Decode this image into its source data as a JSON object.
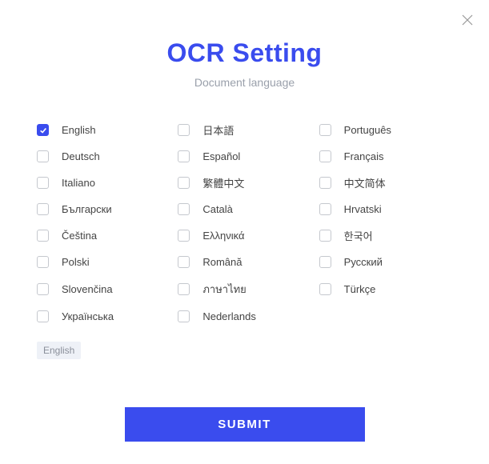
{
  "title": "OCR Setting",
  "subtitle": "Document language",
  "columns": [
    [
      {
        "label": "English",
        "checked": true
      },
      {
        "label": "Deutsch",
        "checked": false
      },
      {
        "label": "Italiano",
        "checked": false
      },
      {
        "label": "Български",
        "checked": false
      },
      {
        "label": "Čeština",
        "checked": false
      },
      {
        "label": "Polski",
        "checked": false
      },
      {
        "label": "Slovenčina",
        "checked": false
      },
      {
        "label": "Українська",
        "checked": false
      }
    ],
    [
      {
        "label": "日本語",
        "checked": false
      },
      {
        "label": "Español",
        "checked": false
      },
      {
        "label": "繁體中文",
        "checked": false
      },
      {
        "label": "Català",
        "checked": false
      },
      {
        "label": "Ελληνικά",
        "checked": false
      },
      {
        "label": "Română",
        "checked": false
      },
      {
        "label": "ภาษาไทย",
        "checked": false
      },
      {
        "label": "Nederlands",
        "checked": false
      }
    ],
    [
      {
        "label": "Português",
        "checked": false
      },
      {
        "label": "Français",
        "checked": false
      },
      {
        "label": "中文简体",
        "checked": false
      },
      {
        "label": "Hrvatski",
        "checked": false
      },
      {
        "label": "한국어",
        "checked": false
      },
      {
        "label": "Русский",
        "checked": false
      },
      {
        "label": "Türkçe",
        "checked": false
      }
    ]
  ],
  "selected_tag": "English",
  "submit_label": "SUBMIT"
}
